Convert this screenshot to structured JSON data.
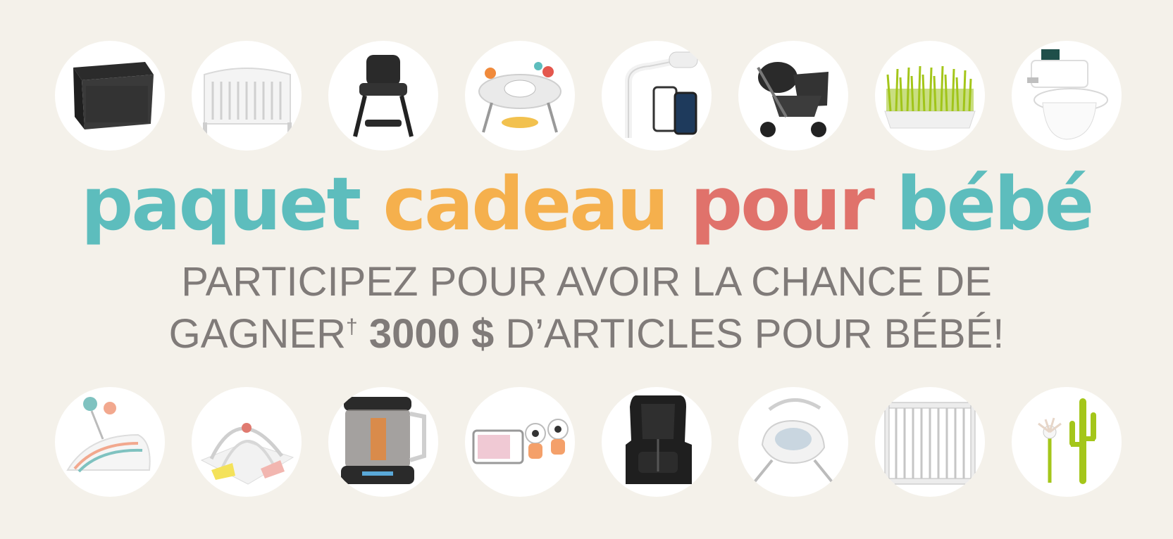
{
  "headline": {
    "word1": "paquet",
    "word2": "cadeau",
    "word3": "pour",
    "word4": "bébé",
    "colors": {
      "teal": "#5dbdbd",
      "orange": "#f5b04d",
      "coral": "#e0726b"
    }
  },
  "subline": {
    "line1": "PARTICIPEZ POUR AVOIR LA CHANCE DE",
    "line2_prefix": "GAGNER",
    "dagger": "†",
    "amount": "3000 $",
    "line2_suffix": "D’ARTICLES POUR BÉBÉ!"
  },
  "products_top": [
    {
      "icon": "playard-icon"
    },
    {
      "icon": "crib-icon"
    },
    {
      "icon": "high-chair-icon"
    },
    {
      "icon": "activity-center-icon"
    },
    {
      "icon": "smart-baby-monitor-icon"
    },
    {
      "icon": "double-stroller-icon"
    },
    {
      "icon": "grass-drying-rack-icon"
    },
    {
      "icon": "potty-training-toilet-icon"
    }
  ],
  "products_bottom": [
    {
      "icon": "baby-bouncer-icon"
    },
    {
      "icon": "play-gym-mat-icon"
    },
    {
      "icon": "baby-food-maker-icon"
    },
    {
      "icon": "video-monitor-set-icon"
    },
    {
      "icon": "car-seat-icon"
    },
    {
      "icon": "baby-swing-icon"
    },
    {
      "icon": "safety-gate-icon"
    },
    {
      "icon": "bottle-rack-accessories-icon"
    }
  ]
}
